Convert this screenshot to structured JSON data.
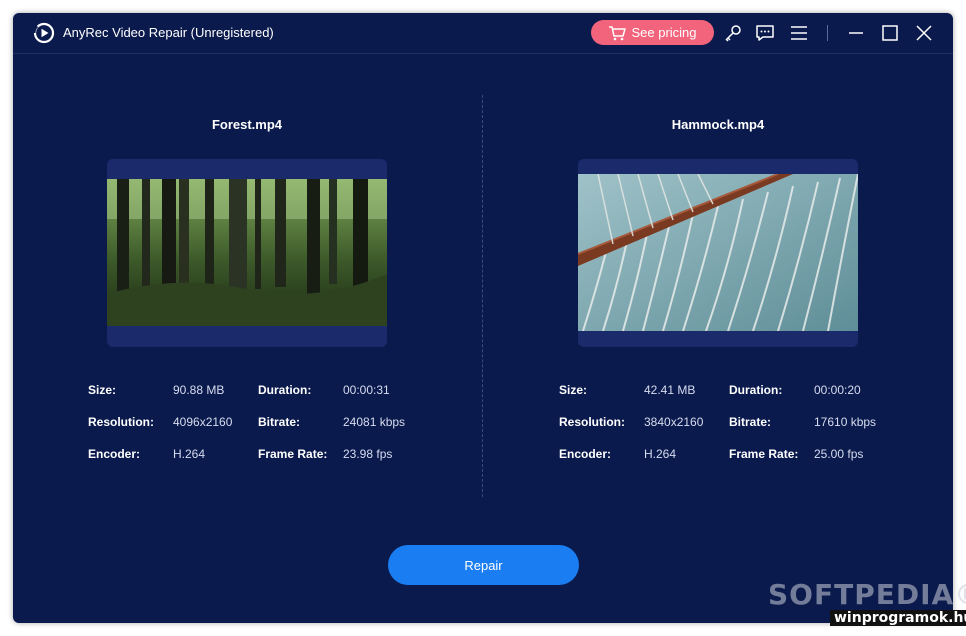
{
  "app": {
    "title": "AnyRec Video Repair (Unregistered)",
    "pricing_label": "See pricing",
    "icons": [
      "play-circle-icon",
      "cart-icon",
      "key-icon",
      "feedback-icon",
      "menu-icon",
      "minimize-icon",
      "maximize-icon",
      "close-icon"
    ]
  },
  "left": {
    "file_name": "Forest.mp4",
    "labels": {
      "size": "Size:",
      "resolution": "Resolution:",
      "encoder": "Encoder:",
      "duration": "Duration:",
      "bitrate": "Bitrate:",
      "frame_rate": "Frame Rate:"
    },
    "values": {
      "size": "90.88 MB",
      "resolution": "4096x2160",
      "encoder": "H.264",
      "duration": "00:00:31",
      "bitrate": "24081 kbps",
      "frame_rate": "23.98 fps"
    }
  },
  "right": {
    "file_name": "Hammock.mp4",
    "labels": {
      "size": "Size:",
      "resolution": "Resolution:",
      "encoder": "Encoder:",
      "duration": "Duration:",
      "bitrate": "Bitrate:",
      "frame_rate": "Frame Rate:"
    },
    "values": {
      "size": "42.41 MB",
      "resolution": "3840x2160",
      "encoder": "H.264",
      "duration": "00:00:20",
      "bitrate": "17610 kbps",
      "frame_rate": "25.00 fps"
    }
  },
  "actions": {
    "repair_label": "Repair"
  },
  "watermarks": {
    "softpedia": "SOFTPEDIA®",
    "site": "winprogramok.hu"
  },
  "colors": {
    "background": "#0b1a4d",
    "pricing": "#f2647c",
    "repair": "#1a7df2"
  }
}
